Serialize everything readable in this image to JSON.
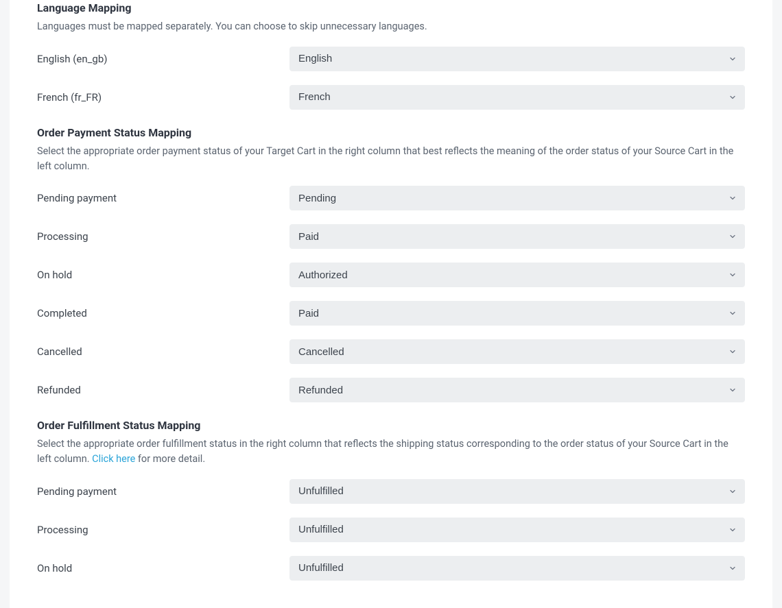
{
  "language_mapping": {
    "title": "Language Mapping",
    "desc": "Languages must be mapped separately. You can choose to skip unnecessary languages.",
    "rows": [
      {
        "label": "English (en_gb)",
        "value": "English"
      },
      {
        "label": "French (fr_FR)",
        "value": "French"
      }
    ]
  },
  "payment_status_mapping": {
    "title": "Order Payment Status Mapping",
    "desc": "Select the appropriate order payment status of your Target Cart in the right column that best reflects the meaning of the order status of your Source Cart in the left column.",
    "rows": [
      {
        "label": "Pending payment",
        "value": "Pending"
      },
      {
        "label": "Processing",
        "value": "Paid"
      },
      {
        "label": "On hold",
        "value": "Authorized"
      },
      {
        "label": "Completed",
        "value": "Paid"
      },
      {
        "label": "Cancelled",
        "value": "Cancelled"
      },
      {
        "label": "Refunded",
        "value": "Refunded"
      }
    ]
  },
  "fulfillment_status_mapping": {
    "title": "Order Fulfillment Status Mapping",
    "desc_pre": "Select the appropriate order fulfillment status in the right column that reflects the shipping status corresponding to the order status of your Source Cart in the left column. ",
    "link_text": "Click here",
    "desc_post": " for more detail.",
    "rows": [
      {
        "label": "Pending payment",
        "value": "Unfulfilled"
      },
      {
        "label": "Processing",
        "value": "Unfulfilled"
      },
      {
        "label": "On hold",
        "value": "Unfulfilled"
      }
    ]
  }
}
